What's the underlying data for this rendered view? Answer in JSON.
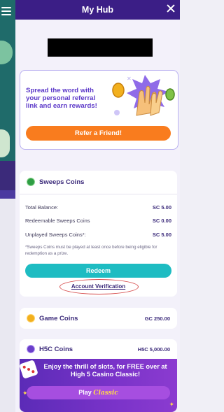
{
  "header": {
    "title": "My Hub"
  },
  "referral": {
    "text": "Spread the word with your personal referral link and earn rewards!",
    "button_label": "Refer a Friend!"
  },
  "sweeps": {
    "title": "Sweeps Coins",
    "rows": [
      {
        "label": "Total Balance:",
        "value": "SC 5.00"
      },
      {
        "label": "Redeemable Sweeps Coins",
        "value": "SC 0.00"
      },
      {
        "label": "Unplayed Sweeps Coins*:",
        "value": "SC 5.00"
      }
    ],
    "note": "*Sweeps Coins must be played at least once before being eligible for redemption as a prize.",
    "redeem_label": "Redeem",
    "verify_label": "Account Verification"
  },
  "game_coins": {
    "title": "Game Coins",
    "value": "GC 250.00"
  },
  "hsc": {
    "title": "H5C Coins",
    "value": "H5C 5,000.00",
    "promo_text": "Enjoy the thrill of slots, for FREE over at High 5 Casino Classic!",
    "play_label": "Play",
    "play_label_accent": "Classic"
  },
  "colors": {
    "header": "#3b1e86",
    "accent_orange": "#f97c1e",
    "accent_teal": "#1ebcc2",
    "text_purple": "#3b2a7a",
    "highlight_red": "#d64b4b"
  },
  "icons": [
    "menu-icon",
    "close-icon",
    "sweeps-coin-icon",
    "game-coin-icon",
    "h5c-coin-icon",
    "high-five-illustration",
    "dice-icon"
  ]
}
